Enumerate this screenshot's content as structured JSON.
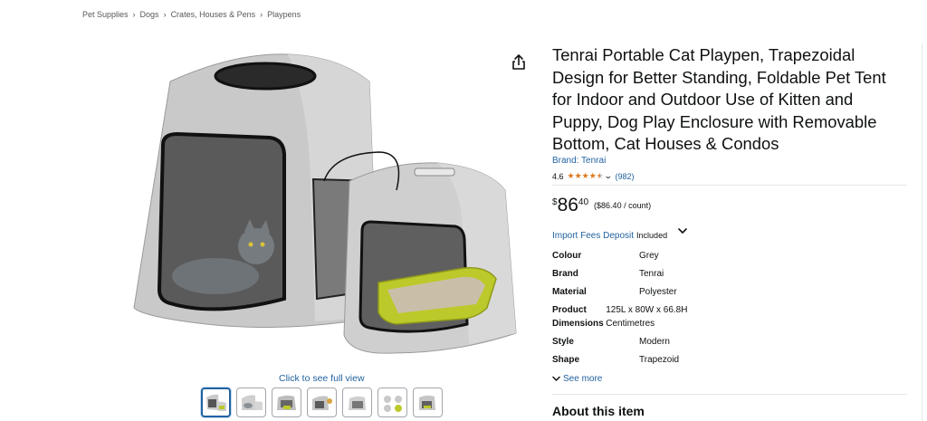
{
  "breadcrumb": {
    "items": [
      "Pet Supplies",
      "Dogs",
      "Crates, Houses & Pens",
      "Playpens"
    ],
    "separator": "›"
  },
  "gallery": {
    "full_view_label": "Click to see full view",
    "thumbnail_count": 7,
    "active_index": 0
  },
  "product": {
    "title": "Tenrai Portable Cat Playpen, Trapezoidal Design for Better Standing, Foldable Pet Tent for Indoor and Outdoor Use of Kitten and Puppy, Dog Play Enclosure with Removable Bottom, Cat Houses & Condos",
    "brand_link": "Brand: Tenrai",
    "rating": "4.6",
    "rating_fraction": 0.92,
    "review_count": "(982)",
    "price": {
      "symbol": "$",
      "whole": "86",
      "fraction": "40",
      "unit_price": "($86.40 / count)"
    },
    "import_fees": {
      "link": "Import Fees Deposit",
      "included": "Included"
    },
    "specs": [
      {
        "key": "Colour",
        "value": "Grey"
      },
      {
        "key": "Brand",
        "value": "Tenrai"
      },
      {
        "key": "Material",
        "value": "Polyester"
      },
      {
        "key": "Product Dimensions",
        "value": "125L x 80W x 66.8H Centimetres"
      },
      {
        "key": "Style",
        "value": "Modern"
      },
      {
        "key": "Shape",
        "value": "Trapezoid"
      }
    ],
    "see_more": "See more",
    "about_heading": "About this item"
  },
  "colors": {
    "link": "#2162a1",
    "star": "#de7921",
    "text": "#0f1111",
    "muted": "#565959"
  }
}
